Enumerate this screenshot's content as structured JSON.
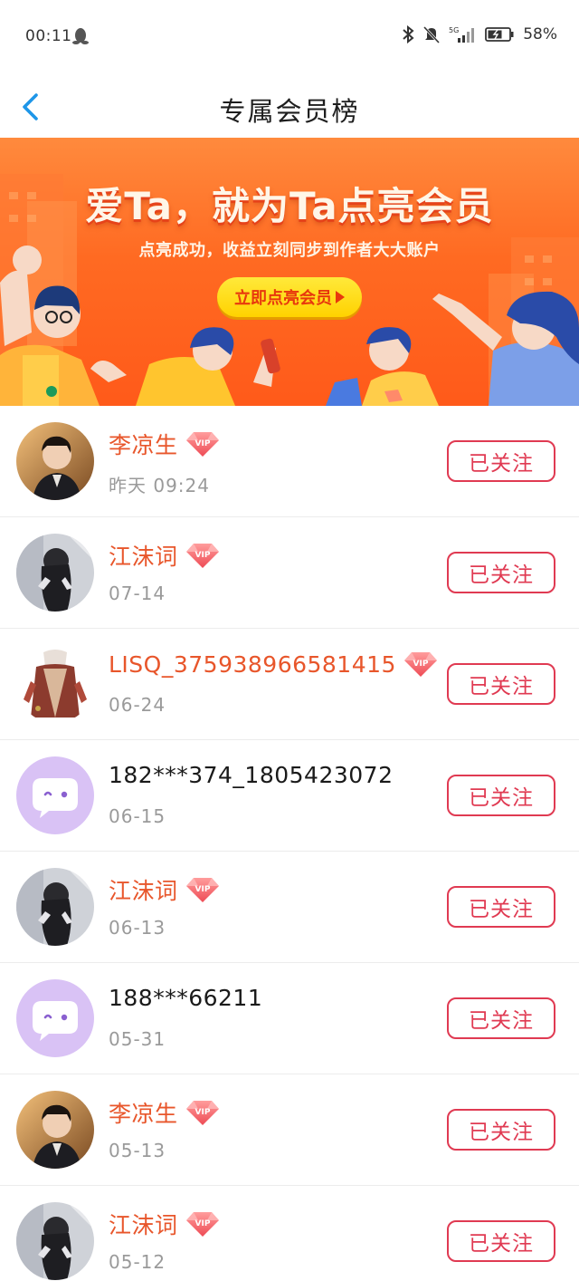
{
  "status_bar": {
    "time": "00:11",
    "network": "5G",
    "battery": "58%",
    "icons": [
      "qq-penguin-icon",
      "bluetooth-icon",
      "mute-bell-icon",
      "signal-icon",
      "battery-icon"
    ]
  },
  "nav": {
    "title": "专属会员榜",
    "back_icon": "chevron-left-icon"
  },
  "banner": {
    "headline": "爱Ta，就为Ta点亮会员",
    "subtitle": "点亮成功，收益立刻同步到作者大大账户",
    "cta_label": "立即点亮会员"
  },
  "members": [
    {
      "name": "李凉生",
      "vip": true,
      "date": "昨天 09:24",
      "button": "已关注",
      "avatar": "photo-boy"
    },
    {
      "name": "江沫词",
      "vip": true,
      "date": "07-14",
      "button": "已关注",
      "avatar": "photo-girl"
    },
    {
      "name": "LISQ_375938966581415",
      "vip": true,
      "date": "06-24",
      "button": "已关注",
      "avatar": "costume"
    },
    {
      "name": "182***374_1805423072",
      "vip": false,
      "date": "06-15",
      "button": "已关注",
      "avatar": "default"
    },
    {
      "name": "江沫词",
      "vip": true,
      "date": "06-13",
      "button": "已关注",
      "avatar": "photo-girl"
    },
    {
      "name": "188***66211",
      "vip": false,
      "date": "05-31",
      "button": "已关注",
      "avatar": "default"
    },
    {
      "name": "李凉生",
      "vip": true,
      "date": "05-13",
      "button": "已关注",
      "avatar": "photo-boy"
    },
    {
      "name": "江沫词",
      "vip": true,
      "date": "05-12",
      "button": "已关注",
      "avatar": "photo-girl"
    }
  ],
  "colors": {
    "accent_red": "#e03a52",
    "vip_name": "#e8562b",
    "banner_orange": "#ff6a22",
    "cta_yellow": "#ffe93a",
    "back_blue": "#1e96e8",
    "default_avatar": "#d9c2f5"
  }
}
